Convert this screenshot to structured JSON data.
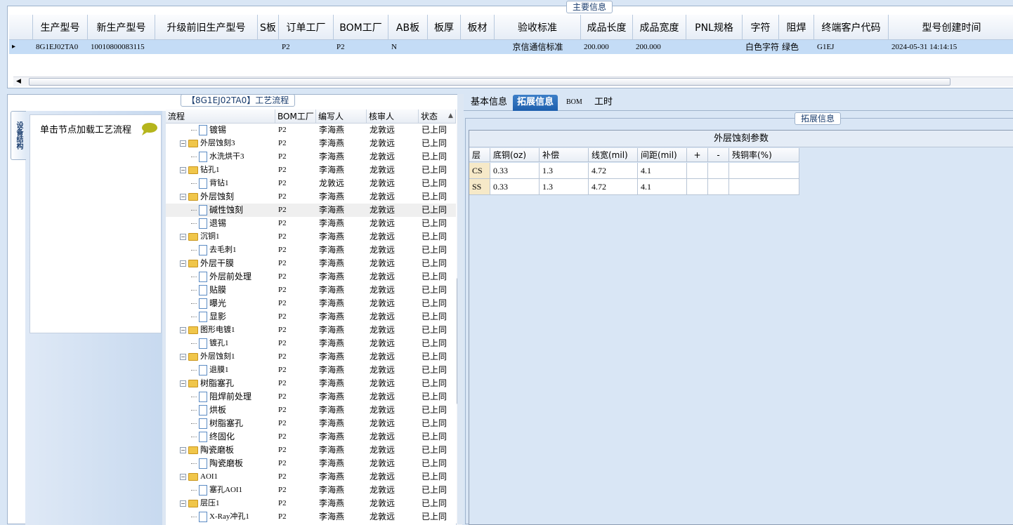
{
  "main_info": {
    "title": "主要信息",
    "columns": [
      "生产型号",
      "新生产型号",
      "升级前旧生产型号",
      "S板",
      "订单工厂",
      "BOM工厂",
      "AB板",
      "板厚",
      "板材",
      "验收标准",
      "成品长度",
      "成品宽度",
      "PNL规格",
      "字符",
      "阻焊",
      "终端客户代码",
      "型号创建时间"
    ],
    "row": [
      "8G1EJ02TA0",
      "10010800083115",
      "",
      "",
      "P2",
      "P2",
      "N",
      "",
      "",
      "京信通信标准",
      "200.000",
      "200.000",
      "",
      "白色字符",
      "绿色",
      "G1EJ",
      "2024-05-31 14:14:15"
    ]
  },
  "process": {
    "title": "【8G1EJ02TA0】工艺流程",
    "side_tab_label": "设备结构",
    "node_hint": "单击节点加载工艺流程",
    "columns": [
      "流程",
      "BOM工厂",
      "编写人",
      "核审人",
      "状态"
    ],
    "rows": [
      {
        "name": "镀锡",
        "kind": "leaf",
        "factory": "P2",
        "writer": "李海燕",
        "reviewer": "龙敦远",
        "status": "已上同"
      },
      {
        "name": "外层蚀刻3",
        "kind": "folder",
        "factory": "P2",
        "writer": "李海燕",
        "reviewer": "龙敦远",
        "status": "已上同"
      },
      {
        "name": "水洗烘干3",
        "kind": "leaf",
        "factory": "P2",
        "writer": "李海燕",
        "reviewer": "龙敦远",
        "status": "已上同"
      },
      {
        "name": "钻孔1",
        "kind": "folder",
        "factory": "P2",
        "writer": "李海燕",
        "reviewer": "龙敦远",
        "status": "已上同"
      },
      {
        "name": "背钻1",
        "kind": "leaf",
        "factory": "P2",
        "writer": "龙敦远",
        "reviewer": "龙敦远",
        "status": "已上同"
      },
      {
        "name": "外层蚀刻",
        "kind": "folder",
        "factory": "P2",
        "writer": "李海燕",
        "reviewer": "龙敦远",
        "status": "已上同"
      },
      {
        "name": "碱性蚀刻",
        "kind": "leaf",
        "factory": "P2",
        "writer": "李海燕",
        "reviewer": "龙敦远",
        "status": "已上同",
        "selected": true
      },
      {
        "name": "退锡",
        "kind": "leaf",
        "factory": "P2",
        "writer": "李海燕",
        "reviewer": "龙敦远",
        "status": "已上同"
      },
      {
        "name": "沉铜1",
        "kind": "folder",
        "factory": "P2",
        "writer": "李海燕",
        "reviewer": "龙敦远",
        "status": "已上同"
      },
      {
        "name": "去毛刺1",
        "kind": "leaf",
        "factory": "P2",
        "writer": "李海燕",
        "reviewer": "龙敦远",
        "status": "已上同"
      },
      {
        "name": "外层干膜",
        "kind": "folder",
        "factory": "P2",
        "writer": "李海燕",
        "reviewer": "龙敦远",
        "status": "已上同"
      },
      {
        "name": "外层前处理",
        "kind": "leaf",
        "factory": "P2",
        "writer": "李海燕",
        "reviewer": "龙敦远",
        "status": "已上同"
      },
      {
        "name": "贴膜",
        "kind": "leaf",
        "factory": "P2",
        "writer": "李海燕",
        "reviewer": "龙敦远",
        "status": "已上同"
      },
      {
        "name": "曝光",
        "kind": "leaf",
        "factory": "P2",
        "writer": "李海燕",
        "reviewer": "龙敦远",
        "status": "已上同"
      },
      {
        "name": "显影",
        "kind": "leaf",
        "factory": "P2",
        "writer": "李海燕",
        "reviewer": "龙敦远",
        "status": "已上同"
      },
      {
        "name": "图形电镀1",
        "kind": "folder",
        "factory": "P2",
        "writer": "李海燕",
        "reviewer": "龙敦远",
        "status": "已上同"
      },
      {
        "name": "镀孔1",
        "kind": "leaf",
        "factory": "P2",
        "writer": "李海燕",
        "reviewer": "龙敦远",
        "status": "已上同"
      },
      {
        "name": "外层蚀刻1",
        "kind": "folder",
        "factory": "P2",
        "writer": "李海燕",
        "reviewer": "龙敦远",
        "status": "已上同"
      },
      {
        "name": "退膜1",
        "kind": "leaf",
        "factory": "P2",
        "writer": "李海燕",
        "reviewer": "龙敦远",
        "status": "已上同"
      },
      {
        "name": "树脂塞孔",
        "kind": "folder",
        "factory": "P2",
        "writer": "李海燕",
        "reviewer": "龙敦远",
        "status": "已上同"
      },
      {
        "name": "阻焊前处理",
        "kind": "leaf",
        "factory": "P2",
        "writer": "李海燕",
        "reviewer": "龙敦远",
        "status": "已上同"
      },
      {
        "name": "烘板",
        "kind": "leaf",
        "factory": "P2",
        "writer": "李海燕",
        "reviewer": "龙敦远",
        "status": "已上同"
      },
      {
        "name": "树脂塞孔",
        "kind": "leaf",
        "factory": "P2",
        "writer": "李海燕",
        "reviewer": "龙敦远",
        "status": "已上同"
      },
      {
        "name": "终固化",
        "kind": "leaf",
        "factory": "P2",
        "writer": "李海燕",
        "reviewer": "龙敦远",
        "status": "已上同"
      },
      {
        "name": "陶瓷磨板",
        "kind": "folder",
        "factory": "P2",
        "writer": "李海燕",
        "reviewer": "龙敦远",
        "status": "已上同"
      },
      {
        "name": "陶瓷磨板",
        "kind": "leaf",
        "factory": "P2",
        "writer": "李海燕",
        "reviewer": "龙敦远",
        "status": "已上同"
      },
      {
        "name": "AOI1",
        "kind": "folder",
        "factory": "P2",
        "writer": "李海燕",
        "reviewer": "龙敦远",
        "status": "已上同"
      },
      {
        "name": "塞孔AOI1",
        "kind": "leaf",
        "factory": "P2",
        "writer": "李海燕",
        "reviewer": "龙敦远",
        "status": "已上同"
      },
      {
        "name": "层压1",
        "kind": "folder",
        "factory": "P2",
        "writer": "李海燕",
        "reviewer": "龙敦远",
        "status": "已上同"
      },
      {
        "name": "X-Ray冲孔1",
        "kind": "leaf",
        "factory": "P2",
        "writer": "李海燕",
        "reviewer": "龙敦远",
        "status": "已上同"
      }
    ]
  },
  "tabs": [
    "基本信息",
    "拓展信息",
    "BOM",
    "工时"
  ],
  "active_tab": "拓展信息",
  "ext": {
    "title": "拓展信息",
    "etch_caption": "外层蚀刻参数",
    "columns": [
      "层",
      "底铜(oz)",
      "补偿",
      "线宽(mil)",
      "间距(mil)",
      "+",
      "-",
      "残铜率(%)"
    ],
    "rows": [
      [
        "CS",
        "0.33",
        "1.3",
        "4.72",
        "4.1",
        "",
        "",
        ""
      ],
      [
        "SS",
        "0.33",
        "1.3",
        "4.72",
        "4.1",
        "",
        "",
        ""
      ]
    ]
  }
}
